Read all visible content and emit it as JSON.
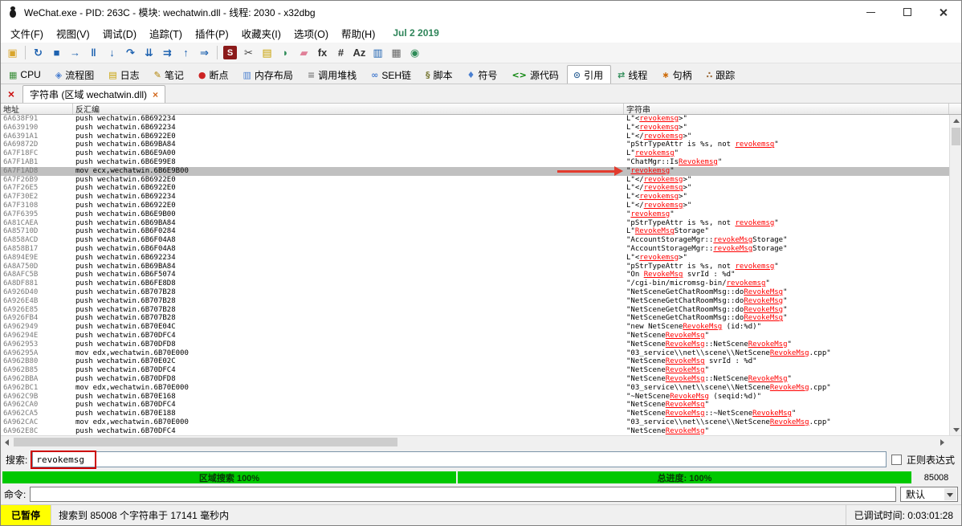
{
  "window": {
    "title": "WeChat.exe - PID: 263C - 模块: wechatwin.dll - 线程: 2030 - x32dbg"
  },
  "menu": {
    "items": [
      {
        "name": "file",
        "label": "文件(F)"
      },
      {
        "name": "view",
        "label": "视图(V)"
      },
      {
        "name": "debug",
        "label": "调试(D)"
      },
      {
        "name": "trace",
        "label": "追踪(T)"
      },
      {
        "name": "plugins",
        "label": "插件(P)"
      },
      {
        "name": "favourites",
        "label": "收藏夹(I)"
      },
      {
        "name": "options",
        "label": "选项(O)"
      },
      {
        "name": "help",
        "label": "帮助(H)"
      }
    ],
    "build_date": "Jul 2 2019"
  },
  "toolbar": {
    "icons": [
      {
        "name": "open-file-icon",
        "glyph": "▣",
        "color": "#d9a52c"
      },
      {
        "sep": true
      },
      {
        "name": "restart-icon",
        "glyph": "↻",
        "color": "#1e62b0"
      },
      {
        "name": "stop-icon",
        "glyph": "■",
        "color": "#1e62b0"
      },
      {
        "name": "run-icon",
        "glyph": "→",
        "color": "#1e62b0"
      },
      {
        "name": "pause-icon",
        "glyph": "‖",
        "color": "#1e62b0"
      },
      {
        "name": "step-into-icon",
        "glyph": "↓",
        "color": "#1e62b0"
      },
      {
        "name": "step-over-icon",
        "glyph": "↷",
        "color": "#1e62b0"
      },
      {
        "name": "animate-into-icon",
        "glyph": "⇊",
        "color": "#1e62b0"
      },
      {
        "name": "animate-over-icon",
        "glyph": "⇉",
        "color": "#1e62b0"
      },
      {
        "name": "execute-till-return-icon",
        "glyph": "↑",
        "color": "#1e62b0"
      },
      {
        "name": "run-to-user-code-icon",
        "glyph": "⇒",
        "color": "#1e62b0"
      },
      {
        "sep": true
      },
      {
        "name": "script-icon",
        "glyph": "S",
        "color": "#ffffff",
        "bg": "#8b1a1a"
      },
      {
        "name": "breakpoint-scissors-icon",
        "glyph": "✂",
        "color": "#444444"
      },
      {
        "name": "log-icon",
        "glyph": "▤",
        "color": "#c8a000"
      },
      {
        "name": "patches-icon",
        "glyph": "◗",
        "color": "#2e8b57"
      },
      {
        "name": "eraser-icon",
        "glyph": "▰",
        "color": "#e08098"
      },
      {
        "name": "fx-icon",
        "glyph": "fx",
        "color": "#333333"
      },
      {
        "name": "hash-icon",
        "glyph": "#",
        "color": "#333333"
      },
      {
        "name": "text-az-icon",
        "glyph": "Az",
        "color": "#333333"
      },
      {
        "name": "memory-map-icon",
        "glyph": "▥",
        "color": "#1e62b0"
      },
      {
        "name": "calculator-icon",
        "glyph": "▦",
        "color": "#666666"
      },
      {
        "name": "spy-icon",
        "glyph": "◉",
        "color": "#2e8b57"
      }
    ]
  },
  "tabs": {
    "selected": "references",
    "items": [
      {
        "name": "cpu",
        "label": "CPU",
        "glyph": "▦",
        "color": "#3a8f3a"
      },
      {
        "name": "graph",
        "label": "流程图",
        "glyph": "◈",
        "color": "#4a7fd0"
      },
      {
        "name": "log",
        "label": "日志",
        "glyph": "▤",
        "color": "#c8a000"
      },
      {
        "name": "notes",
        "label": "笔记",
        "glyph": "✎",
        "color": "#b08000"
      },
      {
        "name": "breakpoints",
        "label": "断点",
        "glyph": "●",
        "color": "#cc2222"
      },
      {
        "name": "memory-map",
        "label": "内存布局",
        "glyph": "▥",
        "color": "#4a7fd0"
      },
      {
        "name": "call-stack",
        "label": "调用堆栈",
        "glyph": "≡",
        "color": "#808080"
      },
      {
        "name": "seh-chain",
        "label": "SEH链",
        "glyph": "∞",
        "color": "#4a7fd0"
      },
      {
        "name": "script",
        "label": "脚本",
        "glyph": "§",
        "color": "#808040"
      },
      {
        "name": "symbols",
        "label": "符号",
        "glyph": "♦",
        "color": "#4a7fd0"
      },
      {
        "name": "source",
        "label": "源代码",
        "glyph": "<>",
        "color": "#008000"
      },
      {
        "name": "references",
        "label": "引用",
        "glyph": "⊙",
        "color": "#336699"
      },
      {
        "name": "threads",
        "label": "线程",
        "glyph": "⇄",
        "color": "#2e8b57"
      },
      {
        "name": "handles",
        "label": "句柄",
        "glyph": "∗",
        "color": "#cc6600"
      },
      {
        "name": "trace",
        "label": "跟踪",
        "glyph": "∴",
        "color": "#996633"
      }
    ]
  },
  "subtab": {
    "close_all_glyph": "×",
    "label": "字符串 (区域 wechatwin.dll)",
    "close_glyph": "×"
  },
  "table": {
    "columns": [
      "地址",
      "反汇编",
      "字符串"
    ],
    "highlight_term": "revokemsg",
    "selected_index": 6,
    "rows": [
      {
        "addr": "6A638F91",
        "disasm": "push wechatwin.6B692234",
        "str": "L\"<revokemsg>\""
      },
      {
        "addr": "6A639190",
        "disasm": "push wechatwin.6B692234",
        "str": "L\"<revokemsg>\""
      },
      {
        "addr": "6A6391A1",
        "disasm": "push wechatwin.6B6922E0",
        "str": "L\"</revokemsg>\""
      },
      {
        "addr": "6A69872D",
        "disasm": "push wechatwin.6B69BA84",
        "str": "\"pStrTypeAttr is %s, not revokemsg\""
      },
      {
        "addr": "6A7F18FC",
        "disasm": "push wechatwin.6B6E9A00",
        "str": "L\"revokemsg\""
      },
      {
        "addr": "6A7F1AB1",
        "disasm": "push wechatwin.6B6E99E8",
        "str": "\"ChatMgr::IsRevokemsg\""
      },
      {
        "addr": "6A7F1AD8",
        "disasm": "mov ecx,wechatwin.6B6E9B00",
        "str": "\"revokemsg\""
      },
      {
        "addr": "6A7F26B9",
        "disasm": "push wechatwin.6B6922E0",
        "str": "L\"</revokemsg>\""
      },
      {
        "addr": "6A7F26E5",
        "disasm": "push wechatwin.6B6922E0",
        "str": "L\"</revokemsg>\""
      },
      {
        "addr": "6A7F30E2",
        "disasm": "push wechatwin.6B692234",
        "str": "L\"<revokemsg>\""
      },
      {
        "addr": "6A7F3108",
        "disasm": "push wechatwin.6B6922E0",
        "str": "L\"</revokemsg>\""
      },
      {
        "addr": "6A7F6395",
        "disasm": "push wechatwin.6B6E9B00",
        "str": "\"revokemsg\""
      },
      {
        "addr": "6A81CAEA",
        "disasm": "push wechatwin.6B69BA84",
        "str": "\"pStrTypeAttr is %s, not revokemsg\""
      },
      {
        "addr": "6A85710D",
        "disasm": "push wechatwin.6B6F0284",
        "str": "L\"RevokeMsgStorage\""
      },
      {
        "addr": "6A858ACD",
        "disasm": "push wechatwin.6B6F04A8",
        "str": "\"AccountStorageMgr::revokeMsgStorage\""
      },
      {
        "addr": "6A858B17",
        "disasm": "push wechatwin.6B6F04A8",
        "str": "\"AccountStorageMgr::revokeMsgStorage\""
      },
      {
        "addr": "6A894E9E",
        "disasm": "push wechatwin.6B692234",
        "str": "L\"<revokemsg>\""
      },
      {
        "addr": "6A8A750D",
        "disasm": "push wechatwin.6B69BA84",
        "str": "\"pStrTypeAttr is %s, not revokemsg\""
      },
      {
        "addr": "6A8AFC5B",
        "disasm": "push wechatwin.6B6F5074",
        "str": "\"On RevokeMsg svrId : %d\""
      },
      {
        "addr": "6A8DF881",
        "disasm": "push wechatwin.6B6FE8D8",
        "str": "\"/cgi-bin/micromsg-bin/revokemsg\""
      },
      {
        "addr": "6A926D40",
        "disasm": "push wechatwin.6B707B28",
        "str": "\"NetSceneGetChatRoomMsg::doRevokeMsg\""
      },
      {
        "addr": "6A926E4B",
        "disasm": "push wechatwin.6B707B28",
        "str": "\"NetSceneGetChatRoomMsg::doRevokeMsg\""
      },
      {
        "addr": "6A926E85",
        "disasm": "push wechatwin.6B707B28",
        "str": "\"NetSceneGetChatRoomMsg::doRevokeMsg\""
      },
      {
        "addr": "6A926FB4",
        "disasm": "push wechatwin.6B707B28",
        "str": "\"NetSceneGetChatRoomMsg::doRevokeMsg\""
      },
      {
        "addr": "6A962949",
        "disasm": "push wechatwin.6B70E04C",
        "str": "\"new NetSceneRevokeMsg (id:%d)\""
      },
      {
        "addr": "6A96294E",
        "disasm": "push wechatwin.6B70DFC4",
        "str": "\"NetSceneRevokeMsg\""
      },
      {
        "addr": "6A962953",
        "disasm": "push wechatwin.6B70DFD8",
        "str": "\"NetSceneRevokeMsg::NetSceneRevokeMsg\""
      },
      {
        "addr": "6A96295A",
        "disasm": "mov edx,wechatwin.6B70E000",
        "str": "\"03_service\\\\net\\\\scene\\\\NetSceneRevokeMsg.cpp\""
      },
      {
        "addr": "6A962B80",
        "disasm": "push wechatwin.6B70E02C",
        "str": "\"NetSceneRevokeMsg svrId : %d\""
      },
      {
        "addr": "6A962B85",
        "disasm": "push wechatwin.6B70DFC4",
        "str": "\"NetSceneRevokeMsg\""
      },
      {
        "addr": "6A962BBA",
        "disasm": "push wechatwin.6B70DFD8",
        "str": "\"NetSceneRevokeMsg::NetSceneRevokeMsg\""
      },
      {
        "addr": "6A962BC1",
        "disasm": "mov edx,wechatwin.6B70E000",
        "str": "\"03_service\\\\net\\\\scene\\\\NetSceneRevokeMsg.cpp\""
      },
      {
        "addr": "6A962C9B",
        "disasm": "push wechatwin.6B70E168",
        "str": "\"~NetSceneRevokeMsg (seqid:%d)\""
      },
      {
        "addr": "6A962CA0",
        "disasm": "push wechatwin.6B70DFC4",
        "str": "\"NetSceneRevokeMsg\""
      },
      {
        "addr": "6A962CA5",
        "disasm": "push wechatwin.6B70E188",
        "str": "\"NetSceneRevokeMsg::~NetSceneRevokeMsg\""
      },
      {
        "addr": "6A962CAC",
        "disasm": "mov edx,wechatwin.6B70E000",
        "str": "\"03_service\\\\net\\\\scene\\\\NetSceneRevokeMsg.cpp\""
      },
      {
        "addr": "6A962E8C",
        "disasm": "push wechatwin.6B70DFC4",
        "str": "\"NetSceneRevokeMsg\""
      }
    ]
  },
  "search": {
    "label": "搜索:",
    "value": "revokemsg",
    "regex_label": "正则表达式"
  },
  "progress": {
    "region_label": "区域搜索 100%",
    "total_label": "总进度: 100%",
    "count": "85008"
  },
  "command": {
    "label": "命令:",
    "value": "",
    "profile_label": "默认"
  },
  "status": {
    "state": "已暂停",
    "message": "搜索到 85008 个字符串于 17141 毫秒内",
    "time": "已调试时间: 0:03:01:28"
  },
  "colors": {
    "match_red": "#ff0000",
    "selected_row": "#c0c0c0",
    "progress_green": "#00c800",
    "paused_yellow": "#ffff00",
    "build_date_green": "#2f855a",
    "annotation_red": "#cc0000"
  }
}
